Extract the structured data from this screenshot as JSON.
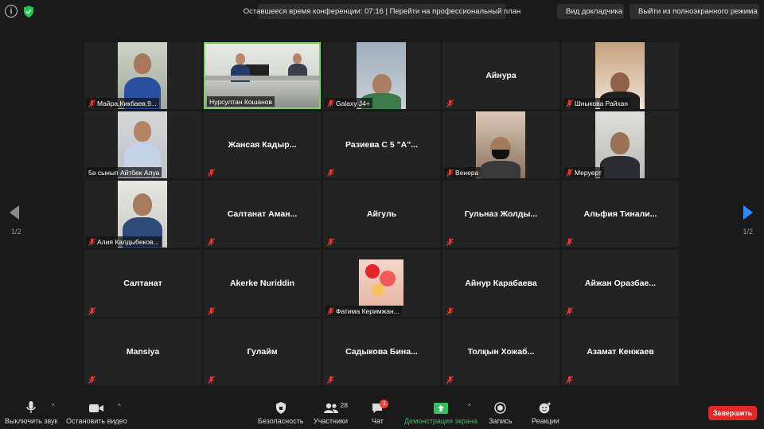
{
  "top": {
    "time_banner": "Оставшееся время конференции: 07:16 | Перейти на профессиональный план",
    "speaker_view": "Вид докладчика",
    "exit_fullscreen": "Выйти из полноэкранного режима"
  },
  "tiles": [
    {
      "name": "Майра,Кикбаев,9...",
      "video": true,
      "active": false,
      "muted": true
    },
    {
      "name": "Нурсултан Кошанов",
      "video": true,
      "active": true,
      "muted": false
    },
    {
      "name": "Galaxy J4+",
      "video": true,
      "active": false,
      "muted": true
    },
    {
      "name": "Айнура",
      "video": false,
      "active": false,
      "muted": true
    },
    {
      "name": "Шныкова Райхан",
      "video": true,
      "active": false,
      "muted": true
    },
    {
      "name": "5ә сынып Айтбек Алуа",
      "video": true,
      "active": false,
      "muted": false
    },
    {
      "name": "Жансая Кадыр...",
      "video": false,
      "active": false,
      "muted": true
    },
    {
      "name": "Разиева С 5 \"А\"...",
      "video": false,
      "active": false,
      "muted": true
    },
    {
      "name": "Венера",
      "video": true,
      "active": false,
      "muted": true
    },
    {
      "name": "Меруерт",
      "video": true,
      "active": false,
      "muted": true
    },
    {
      "name": "Алия Калдыбеков...",
      "video": true,
      "active": false,
      "muted": true
    },
    {
      "name": "Салтанат Аман...",
      "video": false,
      "active": false,
      "muted": true
    },
    {
      "name": "Айгуль",
      "video": false,
      "active": false,
      "muted": true
    },
    {
      "name": "Гульназ Жолды...",
      "video": false,
      "active": false,
      "muted": true
    },
    {
      "name": "Альфия Тинали...",
      "video": false,
      "active": false,
      "muted": true
    },
    {
      "name": "Салтанат",
      "video": false,
      "active": false,
      "muted": true
    },
    {
      "name": "Akerke Nuriddin",
      "video": false,
      "active": false,
      "muted": true
    },
    {
      "name": "Фатима Керимжан...",
      "video": true,
      "active": false,
      "muted": true
    },
    {
      "name": "Айнур Карабаева",
      "video": false,
      "active": false,
      "muted": true
    },
    {
      "name": "Айжан Оразбае...",
      "video": false,
      "active": false,
      "muted": true
    },
    {
      "name": "Mansiya",
      "video": false,
      "active": false,
      "muted": true
    },
    {
      "name": "Гулайм",
      "video": false,
      "active": false,
      "muted": true
    },
    {
      "name": "Садыкова Бина...",
      "video": false,
      "active": false,
      "muted": true
    },
    {
      "name": "Толқын Хожаб...",
      "video": false,
      "active": false,
      "muted": true
    },
    {
      "name": "Азамат Кенжаев",
      "video": false,
      "active": false,
      "muted": true
    }
  ],
  "nav": {
    "prev_page": "1/2",
    "next_page": "1/2"
  },
  "toolbar": {
    "mute": "Выключить звук",
    "stop_video": "Остановить видео",
    "security": "Безопасность",
    "participants": "Участники",
    "participants_count": "28",
    "chat": "Чат",
    "chat_badge": "1",
    "share_screen": "Демонстрация экрана",
    "record": "Запись",
    "reactions": "Реакции",
    "end": "Завершить"
  },
  "colors": {
    "active_border": "#7fd45c",
    "share_green": "#35c25b",
    "end_red": "#e02828",
    "next_arrow": "#2d8cff"
  }
}
